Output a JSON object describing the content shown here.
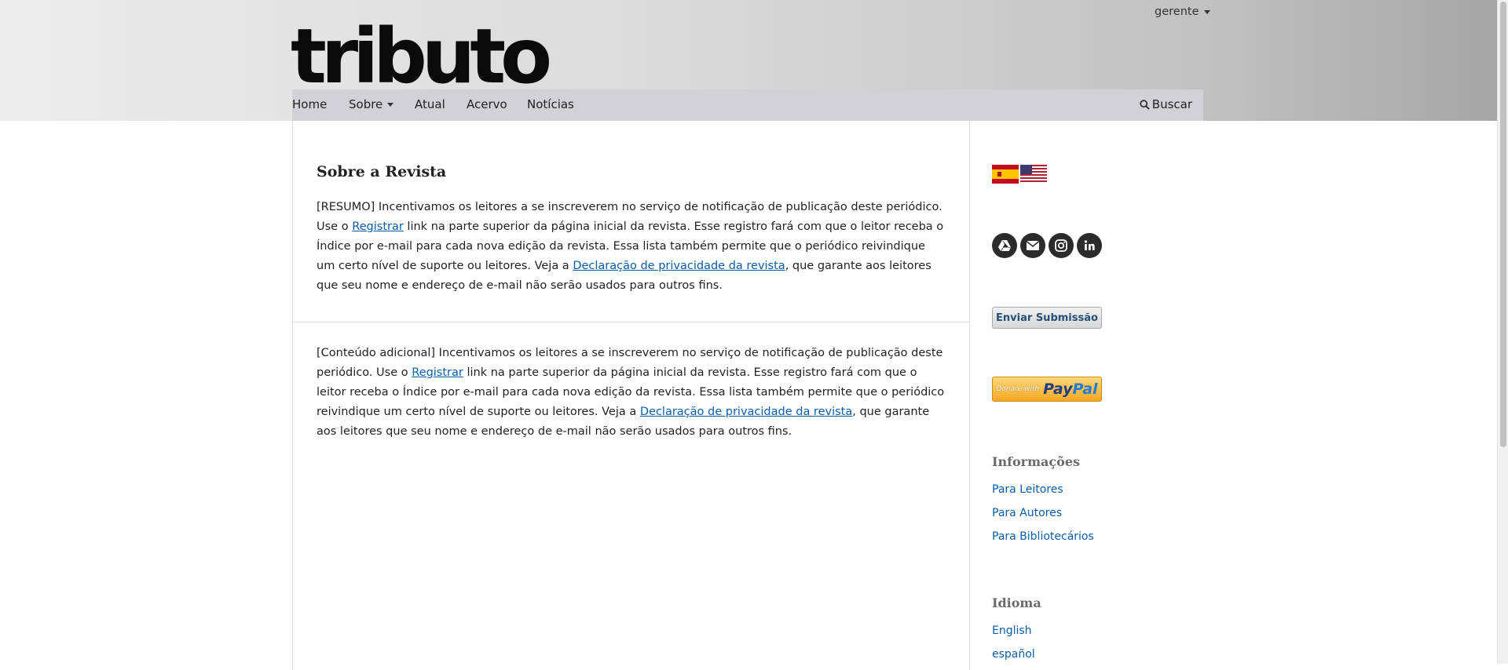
{
  "header": {
    "user_label": "gerente",
    "logo_text": "tributo",
    "nav": [
      "Home",
      "Sobre",
      "Atual",
      "Acervo",
      "Notícias"
    ],
    "search_label": "Buscar"
  },
  "main": {
    "title": "Sobre a Revista",
    "summary": {
      "p1": "[RESUMO] Incentivamos os leitores a se inscreverem no serviço de notificação de publicação deste periódico. Use o ",
      "link1": "Registrar",
      "p2": " link na parte superior da página inicial da revista. Esse registro fará com que o leitor receba o Índice por e-mail para cada nova edição da revista. Essa lista também permite que o periódico reivindique um certo nível de suporte ou leitores. Veja a ",
      "link2": "Declaração de privacidade da revista",
      "p3": ", que garante aos leitores que seu nome e endereço de e-mail não serão usados para outros fins."
    },
    "additional": {
      "p1": "[Conteúdo adicional] Incentivamos os leitores a se inscreverem no serviço de notificação de publicação deste periódico. Use o ",
      "link1": "Registrar",
      "p2": " link na parte superior da página inicial da revista. Esse registro fará com que o leitor receba o Índice por e-mail para cada nova edição da revista. Essa lista também permite que o periódico reivindique um certo nível de suporte ou leitores. Veja a ",
      "link2": "Declaração de privacidade da revista",
      "p3": ", que garante aos leitores que seu nome e endereço de e-mail não serão usados para outros fins."
    }
  },
  "sidebar": {
    "flags": [
      "spain-flag",
      "usa-flag"
    ],
    "social_icons": [
      "google-drive-icon",
      "email-icon",
      "instagram-icon",
      "linkedin-icon"
    ],
    "submit_label": "Enviar Submissão",
    "paypal": {
      "donate": "Donate with",
      "brand_a": "Pay",
      "brand_b": "Pal"
    },
    "info_title": "Informações",
    "info_links": [
      "Para Leitores",
      "Para Autores",
      "Para Bibliotecários"
    ],
    "lang_title": "Idioma",
    "languages": [
      "English",
      "español"
    ]
  },
  "colors": {
    "link": "#0a5ca8",
    "navbar": "#d2d2d6",
    "submit_text": "#264f7a",
    "paypal": "#f4a724"
  }
}
